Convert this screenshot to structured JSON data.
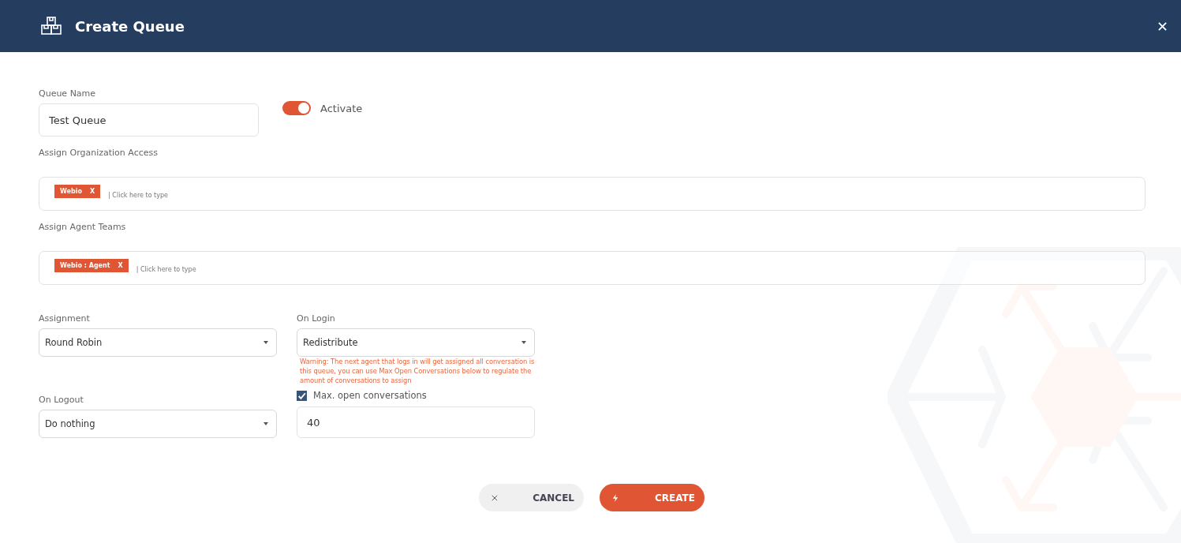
{
  "header": {
    "title": "Create Queue"
  },
  "queue_name": {
    "label": "Queue Name",
    "value": "Test Queue"
  },
  "activate": {
    "label": "Activate",
    "on": true
  },
  "organization_access": {
    "label": "Assign Organization Access",
    "tags": [
      {
        "label": "Webio",
        "remove": "X"
      }
    ],
    "placeholder": "| Click here to type"
  },
  "agent_teams": {
    "label": "Assign Agent Teams",
    "tags": [
      {
        "label": "Webio : Agent",
        "remove": "X"
      }
    ],
    "placeholder": "| Click here to type"
  },
  "assignment": {
    "label": "Assignment",
    "value": "Round Robin"
  },
  "on_login": {
    "label": "On Login",
    "value": "Redistribute",
    "warning": "Warning: The next agent that logs in will get assigned all conversation is this queue, you can use Max Open Conversations below to regulate the amount of conversations to assign"
  },
  "on_logout": {
    "label": "On Logout",
    "value": "Do nothing"
  },
  "max_open": {
    "label": "Max. open conversations",
    "checked": true,
    "value": "40"
  },
  "buttons": [
    {
      "kind": "cancel",
      "label": "CANCEL"
    },
    {
      "kind": "create",
      "label": "CREATE"
    }
  ]
}
